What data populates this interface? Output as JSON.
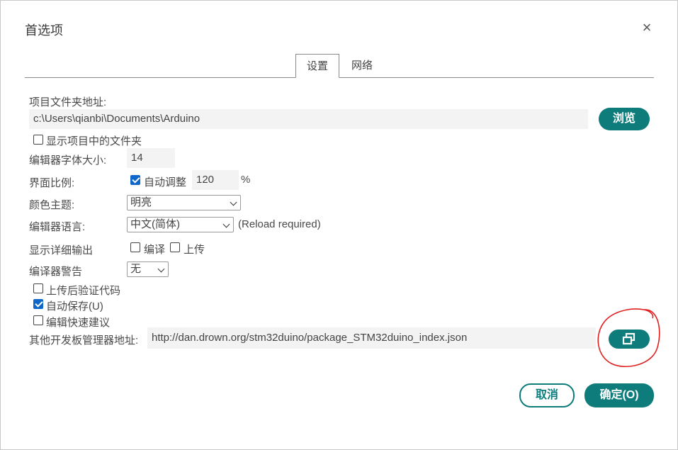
{
  "dialog": {
    "title": "首选项",
    "close_symbol": "×"
  },
  "tabs": [
    {
      "label": "设置",
      "active": true
    },
    {
      "label": "网络",
      "active": false
    }
  ],
  "settings": {
    "sketchbook_label": "项目文件夹地址:",
    "sketchbook_value": "c:\\Users\\qianbi\\Documents\\Arduino",
    "browse_label": "浏览",
    "show_sketch_files_label": "显示项目中的文件夹",
    "show_sketch_files_checked": false,
    "font_size_label": "编辑器字体大小:",
    "font_size_value": "14",
    "scale_label": "界面比例:",
    "auto_scale_label": "自动调整",
    "auto_scale_checked": true,
    "scale_value": "120",
    "scale_unit": "%",
    "theme_label": "颜色主题:",
    "theme_value": "明亮",
    "language_label": "编辑器语言:",
    "language_value": "中文(简体)",
    "language_note": "(Reload required)",
    "verbose_label": "显示详细输出",
    "verbose_compile_label": "编译",
    "verbose_compile_checked": false,
    "verbose_upload_label": "上传",
    "verbose_upload_checked": false,
    "warnings_label": "编译器警告",
    "warnings_value": "无",
    "verify_label": "上传后验证代码",
    "verify_checked": false,
    "autosave_label": "自动保存(U)",
    "autosave_checked": true,
    "quick_suggest_label": "编辑快速建议",
    "quick_suggest_checked": false,
    "board_urls_label": "其他开发板管理器地址:",
    "board_urls_value": "http://dan.drown.org/stm32duino/package_STM32duino_index.json",
    "board_urls_button_icon": "open-window-icon"
  },
  "footer": {
    "cancel_label": "取消",
    "ok_label": "确定(O)"
  },
  "colors": {
    "accent": "#0e7c7b",
    "checkbox": "#0f67c9",
    "annotation": "#e02020"
  }
}
